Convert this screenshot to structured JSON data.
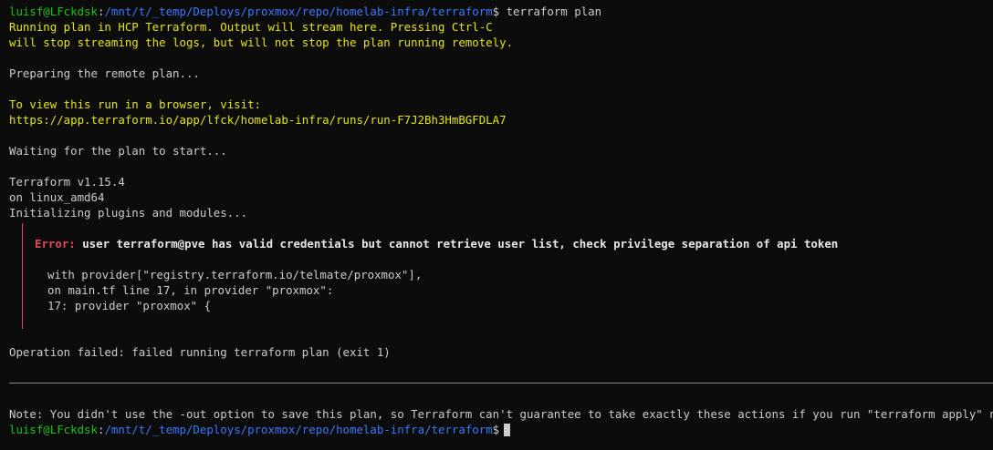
{
  "prompt": {
    "user_host": "luisf@LFckdsk",
    "sep": ":",
    "path": "/mnt/t/_temp/Deploys/proxmox/repo/homelab-infra/terraform",
    "dollar": "$",
    "command": " terraform plan"
  },
  "intro": {
    "line1": "Running plan in HCP Terraform. Output will stream here. Pressing Ctrl-C",
    "line2": "will stop streaming the logs, but will not stop the plan running remotely."
  },
  "preparing": "Preparing the remote plan...",
  "view_run": {
    "label": "To view this run in a browser, visit:",
    "url": "https://app.terraform.io/app/lfck/homelab-infra/runs/run-F7J2Bh3HmBGFDLA7"
  },
  "waiting": "Waiting for the plan to start...",
  "version": {
    "line1": "Terraform v1.15.4",
    "line2": "on linux_amd64",
    "line3": "Initializing plugins and modules..."
  },
  "error": {
    "label": "Error:",
    "message": " user terraform@pve has valid credentials but cannot retrieve user list, check privilege separation of api token",
    "detail1": "with provider[\"registry.terraform.io/telmate/proxmox\"],",
    "detail2": "on main.tf line 17, in provider \"proxmox\":",
    "detail3": "17: provider \"proxmox\" {"
  },
  "operation_failed": "Operation failed: failed running terraform plan (exit 1)",
  "note": "Note: You didn't use the -out option to save this plan, so Terraform can't guarantee to take exactly these actions if you run \"terraform apply\" now.",
  "prompt2": {
    "user_host": "luisf@LFckdsk",
    "sep": ":",
    "path": "/mnt/t/_temp/Deploys/proxmox/repo/homelab-infra/terraform",
    "dollar": "$"
  },
  "colors": {
    "background": "#0c0c0c",
    "user_host": "#16c60c",
    "path": "#3b78ff",
    "highlight_text": "#e5e510",
    "error": "#e74856"
  }
}
